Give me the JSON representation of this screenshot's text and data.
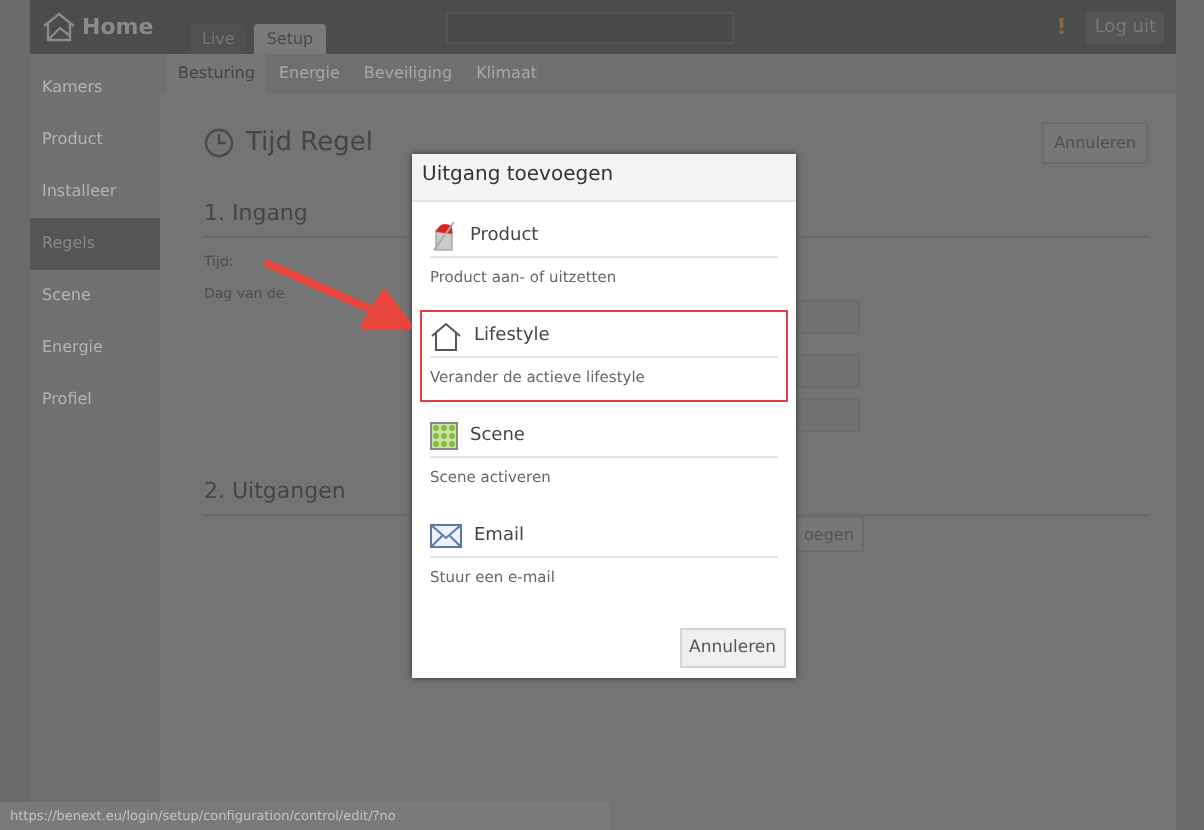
{
  "header": {
    "logo": "Home",
    "tabs": [
      {
        "label": "Live",
        "selected": false
      },
      {
        "label": "Setup",
        "selected": true
      }
    ],
    "alert": "!",
    "logout": "Log uit"
  },
  "subtabs": [
    {
      "label": "Besturing",
      "selected": true
    },
    {
      "label": "Energie",
      "selected": false
    },
    {
      "label": "Beveiliging",
      "selected": false
    },
    {
      "label": "Klimaat",
      "selected": false
    }
  ],
  "sidebar": {
    "items": [
      {
        "label": "Kamers",
        "selected": false
      },
      {
        "label": "Product",
        "selected": false
      },
      {
        "label": "Installeer",
        "selected": false
      },
      {
        "label": "Regels",
        "selected": true
      },
      {
        "label": "Scene",
        "selected": false
      },
      {
        "label": "Energie",
        "selected": false
      },
      {
        "label": "Profiel",
        "selected": false
      }
    ]
  },
  "content": {
    "title": "Tijd Regel",
    "cancel": "Annuleren",
    "input_heading": "1. Ingang",
    "fields": [
      "Tijd:",
      "Dag van de"
    ],
    "output_heading": "2. Uitgangen",
    "add_button": "oegen"
  },
  "dialog": {
    "title": "Uitgang toevoegen",
    "options": [
      {
        "kind": "product",
        "title": "Product",
        "description": "Product aan- of uitzetten",
        "highlighted": false
      },
      {
        "kind": "lifestyle",
        "title": "Lifestyle",
        "description": "Verander de actieve lifestyle",
        "highlighted": true
      },
      {
        "kind": "scene",
        "title": "Scene",
        "description": "Scene activeren",
        "highlighted": false
      },
      {
        "kind": "email",
        "title": "Email",
        "description": "Stuur een e-mail",
        "highlighted": false
      }
    ],
    "cancel": "Annuleren"
  },
  "status_bar": "https://benext.eu/login/setup/configuration/control/edit/?no"
}
